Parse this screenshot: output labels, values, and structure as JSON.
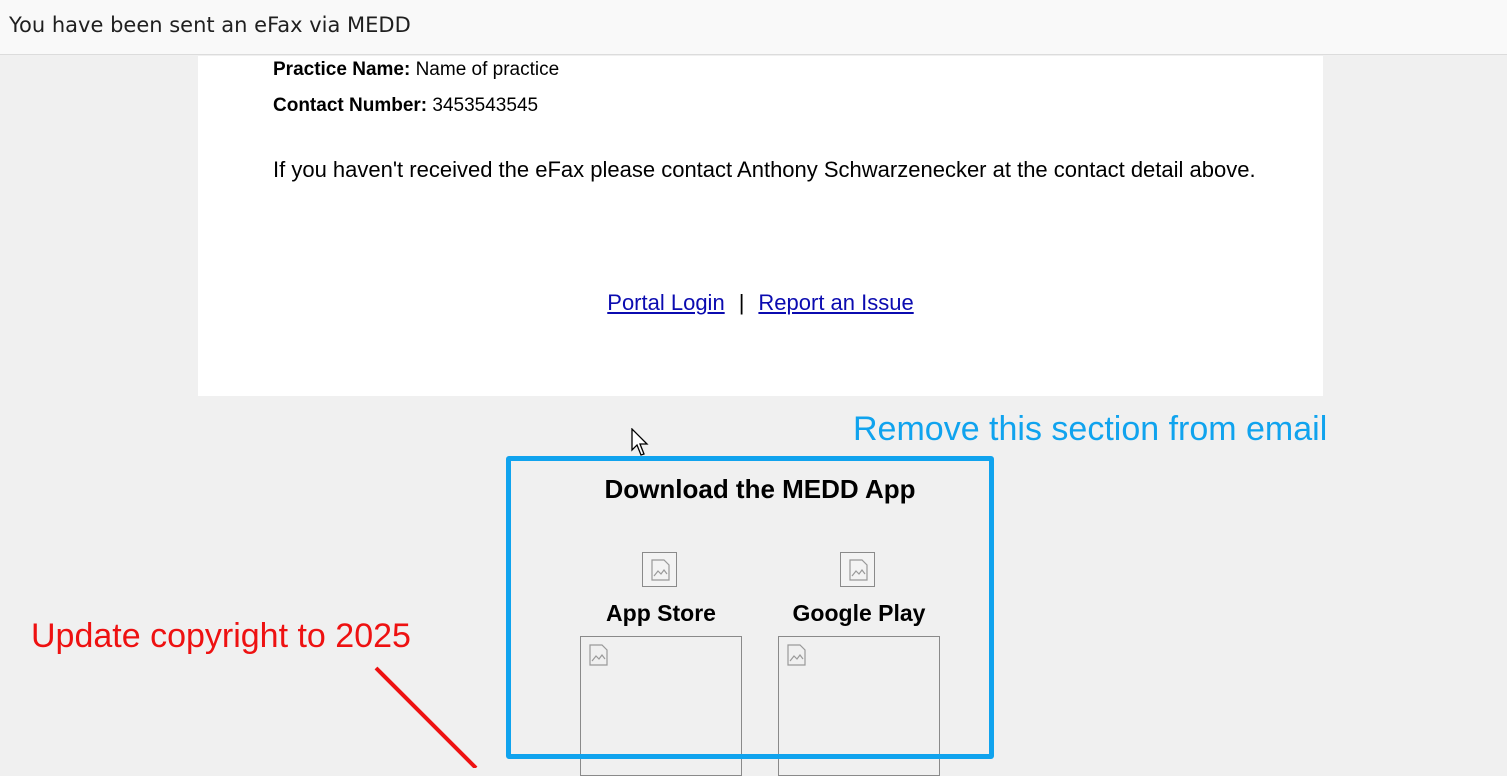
{
  "header": {
    "subject": "You have been sent an eFax via MEDD"
  },
  "email": {
    "practice_label": "Practice Name:",
    "practice_value": "Name of practice",
    "contact_label": "Contact Number:",
    "contact_value": "3453543545",
    "message": "If you haven't received the eFax please contact Anthony Schwarzenecker at the contact detail above.",
    "portal_login": "Portal Login",
    "separator": "|",
    "report_issue": "Report an Issue"
  },
  "app_section": {
    "title": "Download the MEDD App",
    "stores": [
      {
        "label": "App Store",
        "icon": "broken-image-icon"
      },
      {
        "label": "Google Play",
        "icon": "broken-image-icon"
      }
    ]
  },
  "annotations": {
    "remove_note": "Remove this section from email",
    "copyright_note": "Update copyright to 2025",
    "remove_color": "#10a3ee",
    "copyright_color": "#ee1111"
  }
}
